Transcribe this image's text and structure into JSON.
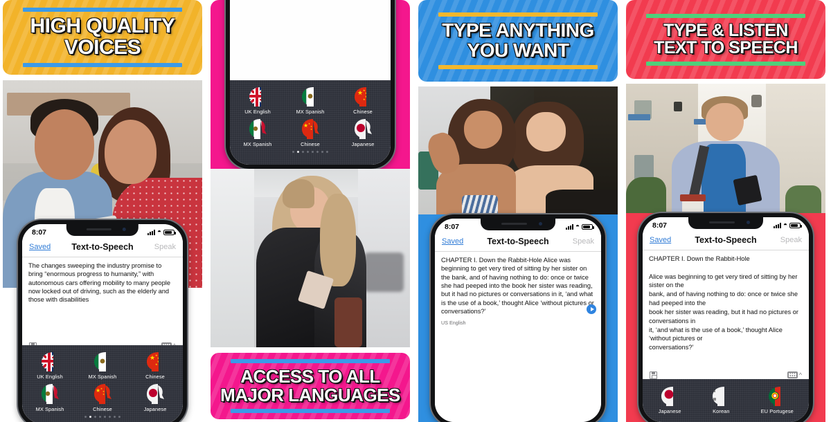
{
  "app": {
    "nav_title": "Text-to-Speech",
    "nav_left": "Saved",
    "nav_right": "Speak",
    "status_time": "8:07"
  },
  "colors": {
    "yellow": "#f2b32a",
    "pink": "#f4178d",
    "blue": "#2f8fe0",
    "red": "#f23b4f",
    "rule_blue": "#3b9ae8",
    "rule_yellow": "#f3b72c",
    "rule_green": "#4fd07a",
    "accent_link": "#2f7bd6",
    "play_blue": "#2f84e0",
    "keypad_dark": "#2f323b"
  },
  "panels": [
    {
      "id": "panel-high-quality-voices",
      "banner": {
        "text": "HIGH QUALITY\nVOICES",
        "bg": "#f2b32a",
        "rule": "#3b9ae8"
      },
      "photo_alt": "couple-on-couch-with-phone",
      "phone": {
        "text": "The changes sweeping the industry promise to bring “enormous progress to humanity,” with autonomous cars offering mobility to many people now locked out of driving, such as the elderly and those with disabilities",
        "lang_tag": "",
        "languages": [
          "UK English",
          "MX Spanish",
          "Chinese",
          "MX Spanish",
          "Chinese",
          "Japanese"
        ],
        "dots_total": 8,
        "dots_active": 1
      }
    },
    {
      "id": "panel-access-all-languages",
      "banner": {
        "text": "ACCESS TO ALL\nMAJOR LANGUAGES",
        "bg": "#f4178d",
        "rule": "#3b9ae8"
      },
      "photo_alt": "woman-walking-in-terminal-with-phone",
      "phone": {
        "text": "",
        "languages": [
          "UK English",
          "MX Spanish",
          "Chinese",
          "MX Spanish",
          "Chinese",
          "Japanese"
        ],
        "dots_total": 8,
        "dots_active": 1
      }
    },
    {
      "id": "panel-type-anything",
      "banner": {
        "text": "TYPE ANYTHING\nYOU WANT",
        "bg": "#2f8fe0",
        "rule": "#f3b72c"
      },
      "photo_alt": "two-women-laughing",
      "phone": {
        "text": "CHAPTER I. Down the Rabbit-Hole  Alice was beginning to get very tired of sitting by her sister on the bank, and of having nothing to do: once or twice she had peeped into the book her sister was reading, but it had no pictures or conversations in it, ‘and what is the use of a book,’ thought Alice ‘without pictures or conversations?’",
        "lang_tag": "US English",
        "has_play_button": true
      }
    },
    {
      "id": "panel-type-and-listen",
      "banner": {
        "text": "TYPE & LISTEN\nTEXT TO SPEECH",
        "bg": "#f23b4f",
        "rule": "#4fd07a"
      },
      "photo_alt": "man-on-street-with-phone-and-coffee",
      "phone": {
        "text": "CHAPTER I. Down the Rabbit-Hole\n\nAlice was beginning to get very tired of sitting by her sister on the\nbank, and of having nothing to do: once or twice she had peeped into the\nbook her sister was reading, but it had no pictures or conversations in\nit, ‘and what is the use of a book,’ thought Alice ‘without pictures or\nconversations?’",
        "languages": [
          "Japanese",
          "Korean",
          "EU Portugese"
        ]
      }
    }
  ],
  "icons": {
    "save": "save-icon",
    "keyboard": "keyboard-icon",
    "chevron": "^",
    "wifi": "wifi-icon",
    "battery": "battery-icon",
    "signal": "signal-icon",
    "play": "play-icon"
  }
}
